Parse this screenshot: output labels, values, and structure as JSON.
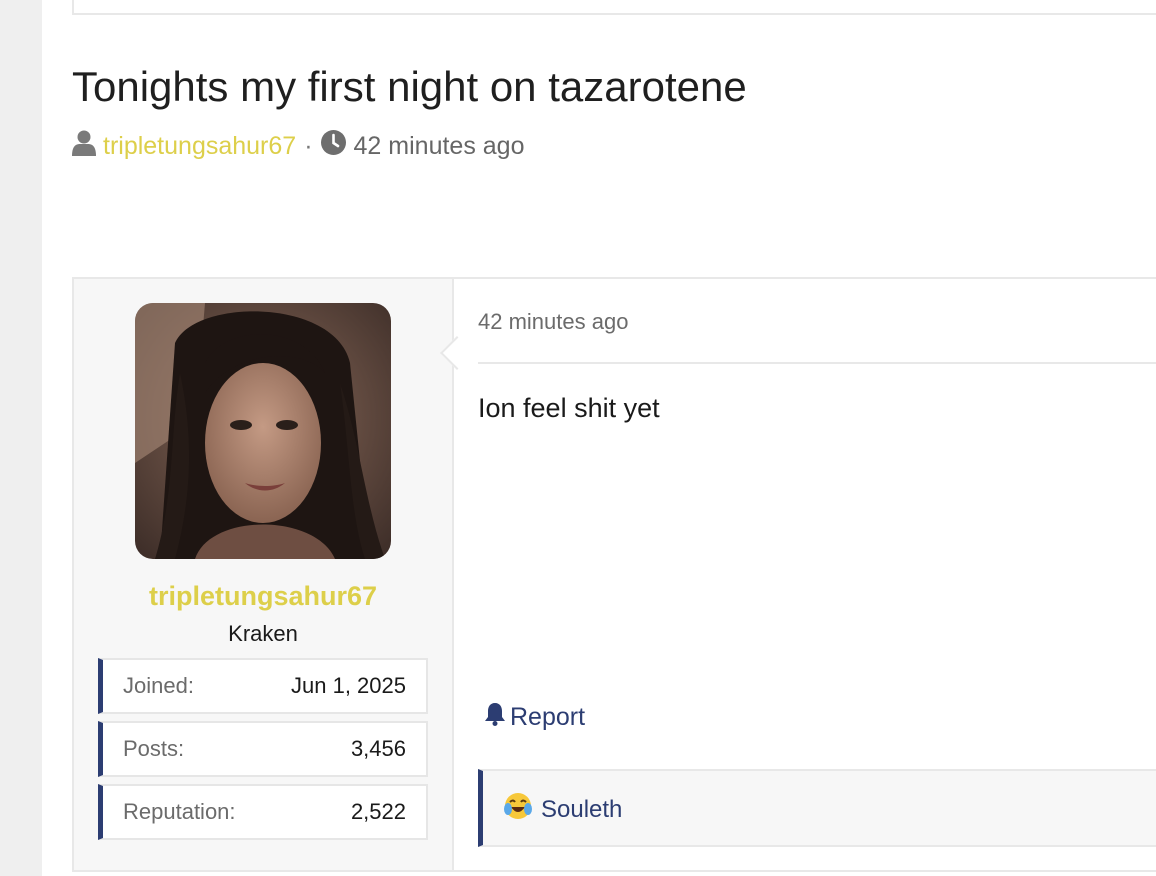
{
  "thread": {
    "title": "Tonights my first night on tazarotene",
    "author": "tripletungsahur67",
    "separator": "·",
    "time": "42 minutes ago",
    "author_icon": "user-icon",
    "time_icon": "clock-icon"
  },
  "post": {
    "author": {
      "name": "tripletungsahur67",
      "rank": "Kraken",
      "stats": [
        {
          "label": "Joined:",
          "value": "Jun 1, 2025"
        },
        {
          "label": "Posts:",
          "value": "3,456"
        },
        {
          "label": "Reputation:",
          "value": "2,522"
        }
      ]
    },
    "date": "42 minutes ago",
    "body": "Ion feel shit yet",
    "report_label": "Report",
    "report_icon": "bell-icon",
    "reactions": [
      {
        "emoji": "joy-tears-emoji",
        "user": "Souleth"
      }
    ]
  },
  "colors": {
    "username": "#ddcf4a",
    "accent": "#2c3d72",
    "panel_bg": "#f7f7f7",
    "border": "#e8e8e8"
  }
}
